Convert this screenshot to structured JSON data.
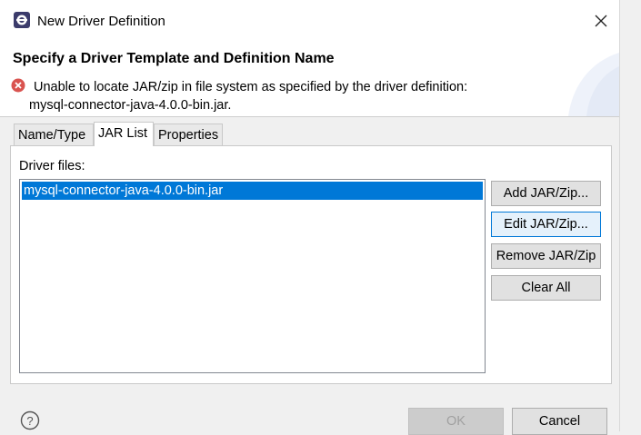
{
  "window": {
    "title": "New Driver Definition",
    "close_icon": "close-icon"
  },
  "banner": {
    "heading": "Specify a Driver Template and Definition Name",
    "error_line1": "Unable to locate JAR/zip in file system as specified by the driver definition:",
    "error_line2": "mysql-connector-java-4.0.0-bin.jar.",
    "error_color": "#d9534f"
  },
  "tabs": [
    {
      "label": "Name/Type",
      "active": false
    },
    {
      "label": "JAR List",
      "active": true
    },
    {
      "label": "Properties",
      "active": false
    }
  ],
  "jar_list": {
    "label": "Driver files:",
    "items": [
      "mysql-connector-java-4.0.0-bin.jar"
    ],
    "selected_color": "#0078d7"
  },
  "side_buttons": {
    "add": "Add JAR/Zip...",
    "edit": "Edit JAR/Zip...",
    "remove": "Remove JAR/Zip",
    "clear": "Clear All"
  },
  "footer": {
    "ok": "OK",
    "cancel": "Cancel",
    "help_icon": "help-icon"
  }
}
